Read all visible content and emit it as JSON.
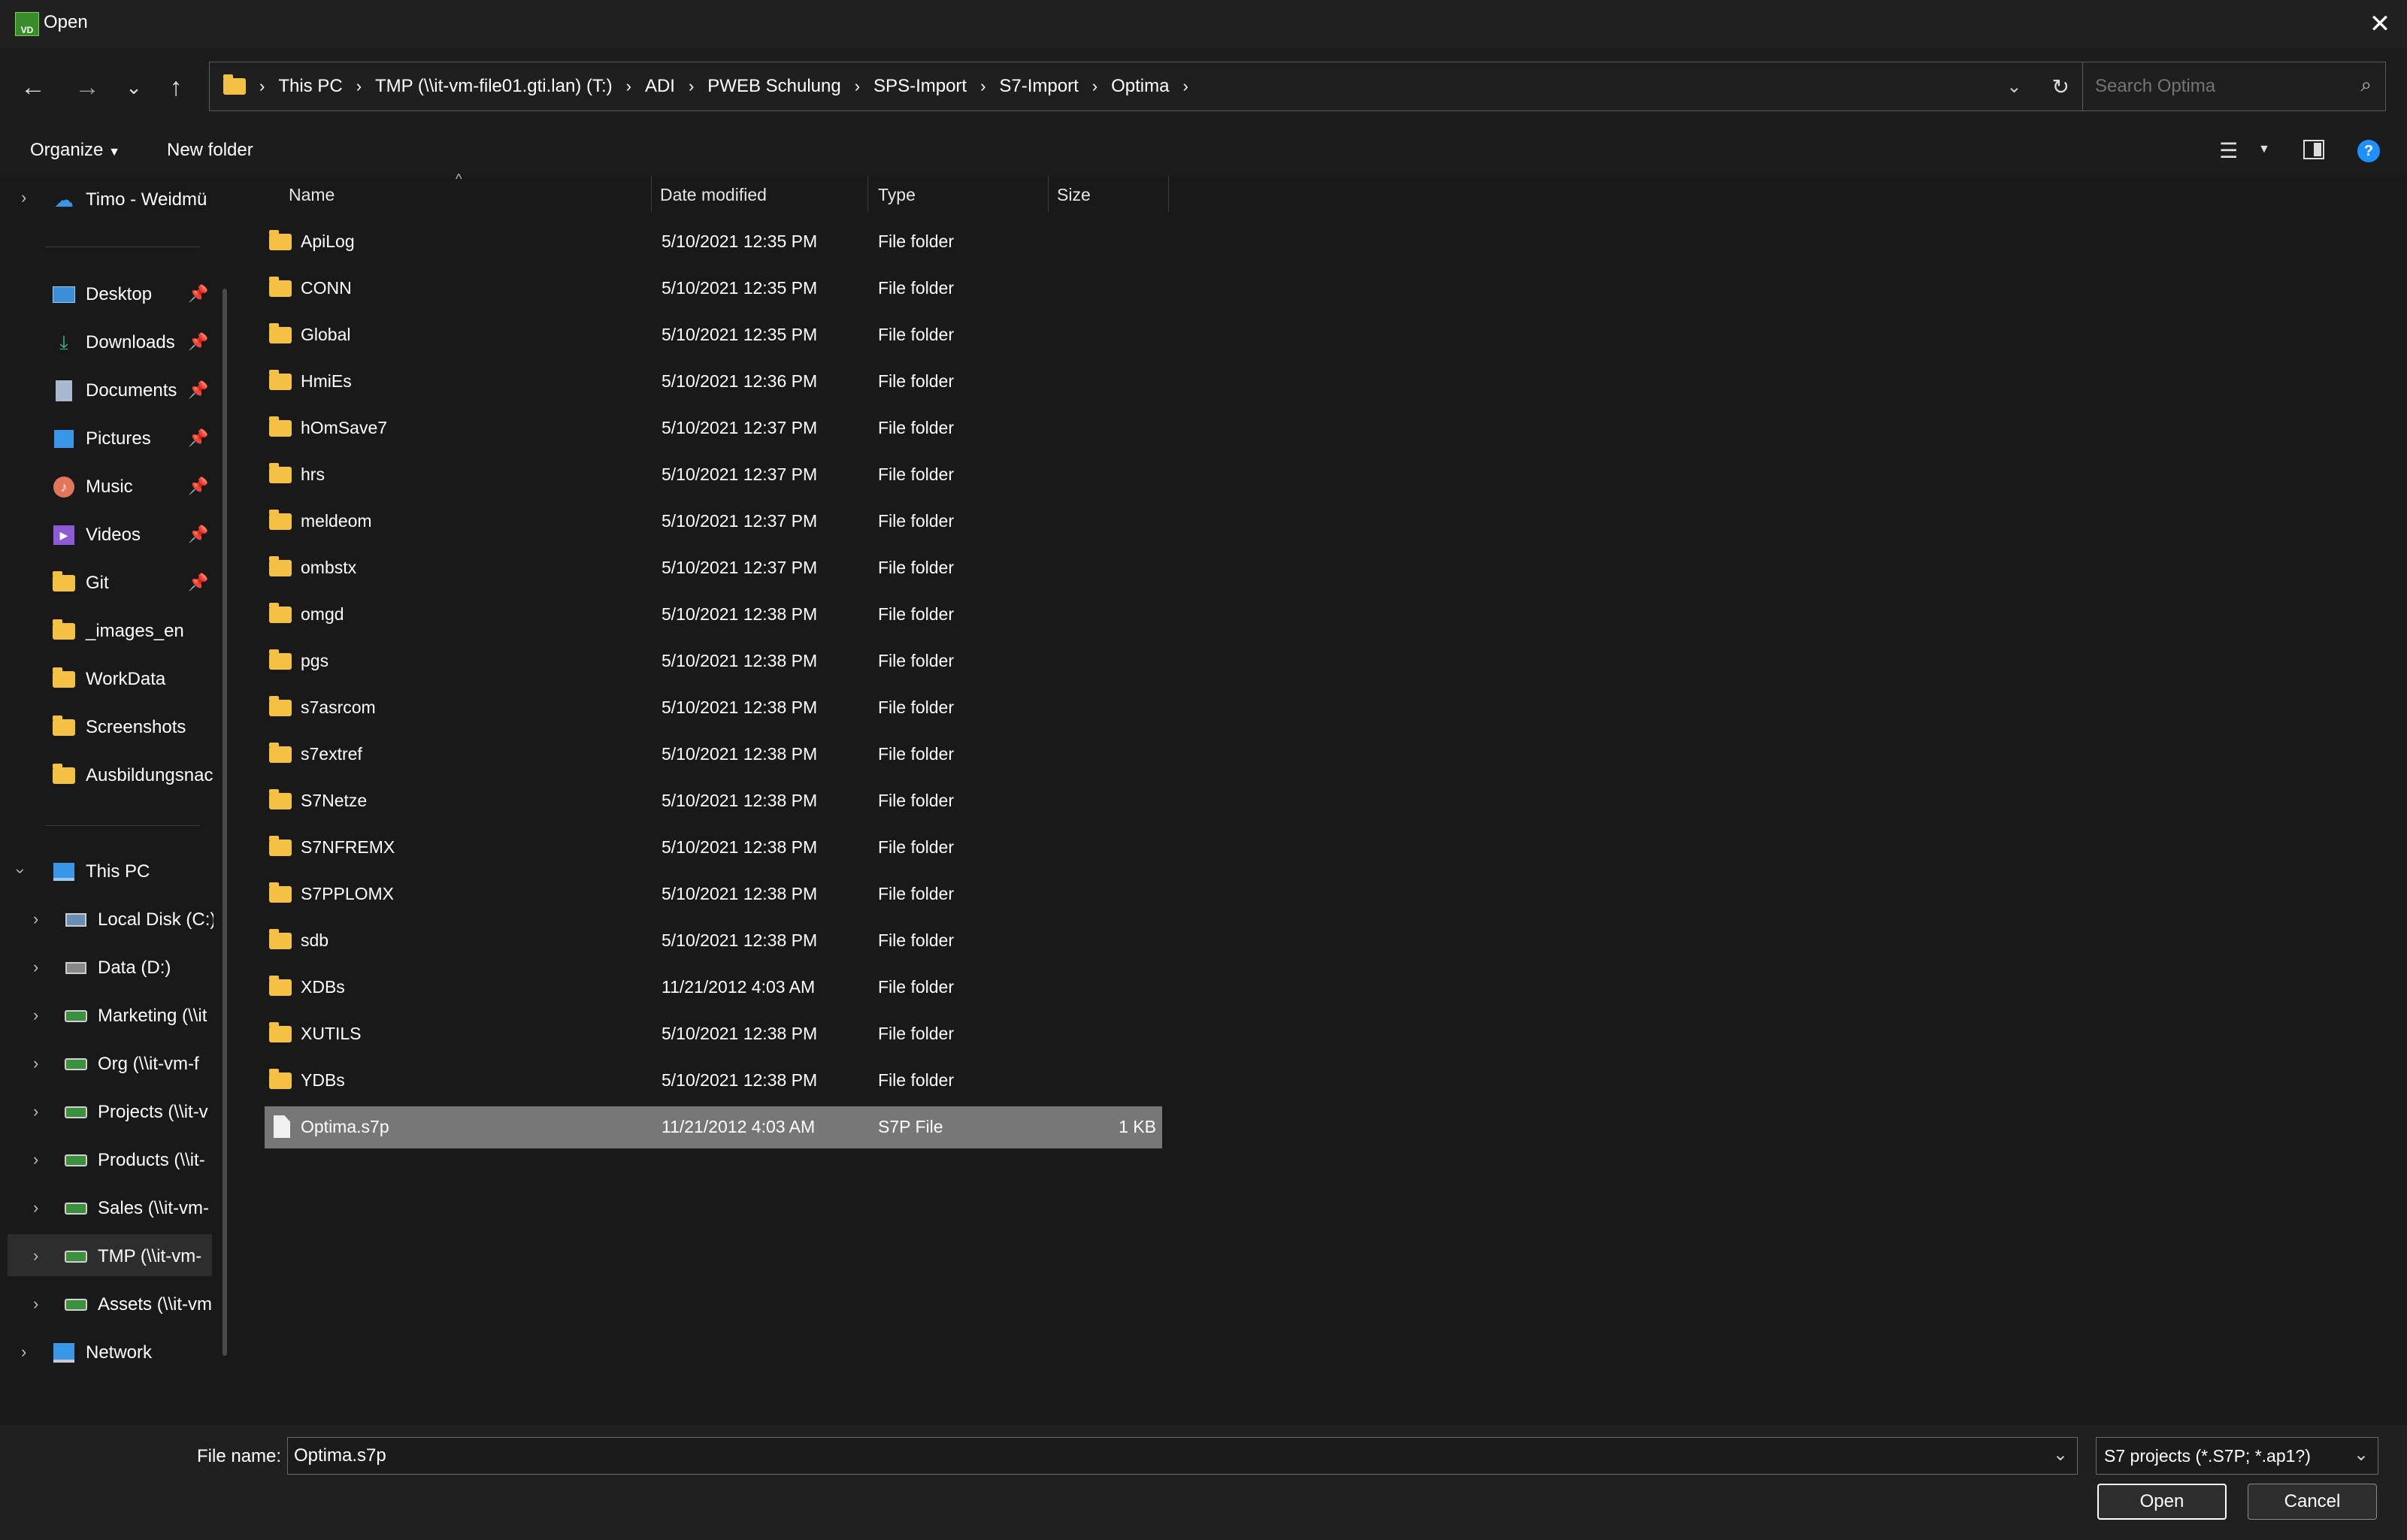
{
  "window": {
    "title": "Open",
    "app_icon": "VD"
  },
  "nav": {
    "back_icon": "arrow-left",
    "forward_icon": "arrow-right",
    "recent_icon": "chevron-down",
    "up_icon": "arrow-up",
    "breadcrumb": [
      "This PC",
      "TMP (\\\\it-vm-file01.gti.lan) (T:)",
      "ADI",
      "PWEB Schulung",
      "SPS-Import",
      "S7-Import",
      "Optima"
    ],
    "search_placeholder": "Search Optima"
  },
  "toolbar": {
    "organize_label": "Organize",
    "new_folder_label": "New folder"
  },
  "sidebar": {
    "cloud_item": "Timo - Weidmü",
    "quick_access": [
      {
        "label": "Desktop",
        "icon": "desktop-icon",
        "pinned": true
      },
      {
        "label": "Downloads",
        "icon": "download-icon",
        "pinned": true
      },
      {
        "label": "Documents",
        "icon": "documents-icon",
        "pinned": true
      },
      {
        "label": "Pictures",
        "icon": "pictures-icon",
        "pinned": true
      },
      {
        "label": "Music",
        "icon": "music-icon",
        "pinned": true
      },
      {
        "label": "Videos",
        "icon": "videos-icon",
        "pinned": true
      },
      {
        "label": "Git",
        "icon": "folder-icon",
        "pinned": true
      },
      {
        "label": "_images_en",
        "icon": "folder-icon",
        "pinned": false
      },
      {
        "label": "WorkData",
        "icon": "folder-icon",
        "pinned": false
      },
      {
        "label": "Screenshots",
        "icon": "folder-icon",
        "pinned": false
      },
      {
        "label": "Ausbildungsnac",
        "icon": "folder-icon",
        "pinned": false
      }
    ],
    "this_pc": "This PC",
    "drives": [
      "Local Disk (C:)",
      "Data (D:)",
      "Marketing (\\\\it",
      "Org (\\\\it-vm-f",
      "Projects (\\\\it-v",
      "Products (\\\\it-",
      "Sales (\\\\it-vm-",
      "TMP (\\\\it-vm-",
      "Assets (\\\\it-vm"
    ],
    "network": "Network"
  },
  "columns": {
    "name": "Name",
    "date": "Date modified",
    "type": "Type",
    "size": "Size"
  },
  "files": [
    {
      "name": "ApiLog",
      "date": "5/10/2021 12:35 PM",
      "type": "File folder",
      "size": ""
    },
    {
      "name": "CONN",
      "date": "5/10/2021 12:35 PM",
      "type": "File folder",
      "size": ""
    },
    {
      "name": "Global",
      "date": "5/10/2021 12:35 PM",
      "type": "File folder",
      "size": ""
    },
    {
      "name": "HmiEs",
      "date": "5/10/2021 12:36 PM",
      "type": "File folder",
      "size": ""
    },
    {
      "name": "hOmSave7",
      "date": "5/10/2021 12:37 PM",
      "type": "File folder",
      "size": ""
    },
    {
      "name": "hrs",
      "date": "5/10/2021 12:37 PM",
      "type": "File folder",
      "size": ""
    },
    {
      "name": "meldeom",
      "date": "5/10/2021 12:37 PM",
      "type": "File folder",
      "size": ""
    },
    {
      "name": "ombstx",
      "date": "5/10/2021 12:37 PM",
      "type": "File folder",
      "size": ""
    },
    {
      "name": "omgd",
      "date": "5/10/2021 12:38 PM",
      "type": "File folder",
      "size": ""
    },
    {
      "name": "pgs",
      "date": "5/10/2021 12:38 PM",
      "type": "File folder",
      "size": ""
    },
    {
      "name": "s7asrcom",
      "date": "5/10/2021 12:38 PM",
      "type": "File folder",
      "size": ""
    },
    {
      "name": "s7extref",
      "date": "5/10/2021 12:38 PM",
      "type": "File folder",
      "size": ""
    },
    {
      "name": "S7Netze",
      "date": "5/10/2021 12:38 PM",
      "type": "File folder",
      "size": ""
    },
    {
      "name": "S7NFREMX",
      "date": "5/10/2021 12:38 PM",
      "type": "File folder",
      "size": ""
    },
    {
      "name": "S7PPLOMX",
      "date": "5/10/2021 12:38 PM",
      "type": "File folder",
      "size": ""
    },
    {
      "name": "sdb",
      "date": "5/10/2021 12:38 PM",
      "type": "File folder",
      "size": ""
    },
    {
      "name": "XDBs",
      "date": "11/21/2012 4:03 AM",
      "type": "File folder",
      "size": ""
    },
    {
      "name": "XUTILS",
      "date": "5/10/2021 12:38 PM",
      "type": "File folder",
      "size": ""
    },
    {
      "name": "YDBs",
      "date": "5/10/2021 12:38 PM",
      "type": "File folder",
      "size": ""
    },
    {
      "name": "Optima.s7p",
      "date": "11/21/2012 4:03 AM",
      "type": "S7P File",
      "size": "1 KB",
      "selected": true
    }
  ],
  "footer": {
    "file_name_label": "File name:",
    "file_name_value": "Optima.s7p",
    "filter": "S7 projects (*.S7P; *.ap1?)",
    "open_label": "Open",
    "cancel_label": "Cancel"
  },
  "colors": {
    "background": "#191919",
    "selected_row": "#777777",
    "folder": "#f5c142",
    "help": "#1e90ff"
  }
}
